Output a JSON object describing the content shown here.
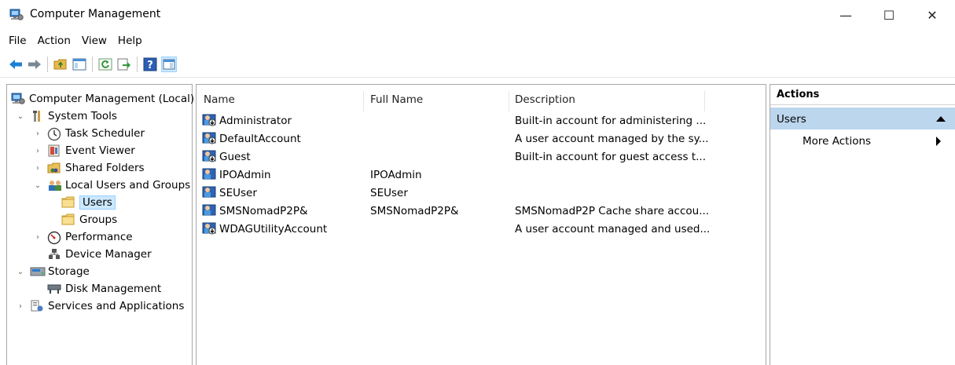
{
  "window": {
    "title": "Computer Management",
    "minimize": "—",
    "maximize": "☐",
    "close": "✕"
  },
  "menu": [
    "File",
    "Action",
    "View",
    "Help"
  ],
  "toolbar": {
    "buttons": [
      "back-icon",
      "forward-icon",
      "up-folder-icon",
      "show-hide-tree-icon",
      "refresh-icon",
      "export-list-icon",
      "help-icon",
      "show-hide-action-pane-icon"
    ]
  },
  "tree": {
    "items": [
      {
        "label": "Computer Management (Local)",
        "expander": "",
        "icon": "computer-management-icon"
      },
      {
        "label": "System Tools",
        "expander": "⌄",
        "icon": "tools-icon"
      },
      {
        "label": "Task Scheduler",
        "expander": "›",
        "icon": "clock-icon"
      },
      {
        "label": "Event Viewer",
        "expander": "›",
        "icon": "event-viewer-icon"
      },
      {
        "label": "Shared Folders",
        "expander": "›",
        "icon": "shared-folders-icon"
      },
      {
        "label": "Local Users and Groups",
        "expander": "⌄",
        "icon": "users-groups-icon"
      },
      {
        "label": "Users",
        "expander": "",
        "icon": "folder-icon"
      },
      {
        "label": "Groups",
        "expander": "",
        "icon": "folder-icon"
      },
      {
        "label": "Performance",
        "expander": "›",
        "icon": "performance-icon"
      },
      {
        "label": "Device Manager",
        "expander": "",
        "icon": "device-manager-icon"
      },
      {
        "label": "Storage",
        "expander": "⌄",
        "icon": "storage-icon"
      },
      {
        "label": "Disk Management",
        "expander": "",
        "icon": "disk-icon"
      },
      {
        "label": "Services and Applications",
        "expander": "›",
        "icon": "services-icon"
      }
    ]
  },
  "list": {
    "columns": [
      "Name",
      "Full Name",
      "Description"
    ],
    "rows": [
      {
        "name": "Administrator",
        "full_name": "",
        "description": "Built-in account for administering ...",
        "disabled": true
      },
      {
        "name": "DefaultAccount",
        "full_name": "",
        "description": "A user account managed by the sy...",
        "disabled": true
      },
      {
        "name": "Guest",
        "full_name": "",
        "description": "Built-in account for guest access t...",
        "disabled": true
      },
      {
        "name": "IPOAdmin",
        "full_name": "IPOAdmin",
        "description": "",
        "disabled": false
      },
      {
        "name": "SEUser",
        "full_name": "SEUser",
        "description": "",
        "disabled": false
      },
      {
        "name": "SMSNomadP2P&",
        "full_name": "SMSNomadP2P&",
        "description": "SMSNomadP2P Cache share accou...",
        "disabled": false
      },
      {
        "name": "WDAGUtilityAccount",
        "full_name": "",
        "description": "A user account managed and used...",
        "disabled": true
      }
    ]
  },
  "actions": {
    "header": "Actions",
    "section": "Users",
    "items": [
      "More Actions"
    ]
  },
  "colors": {
    "selection": "#cce8ff",
    "actions_section": "#bcd6ee",
    "toolbar_blue": "#1e7fd6"
  }
}
